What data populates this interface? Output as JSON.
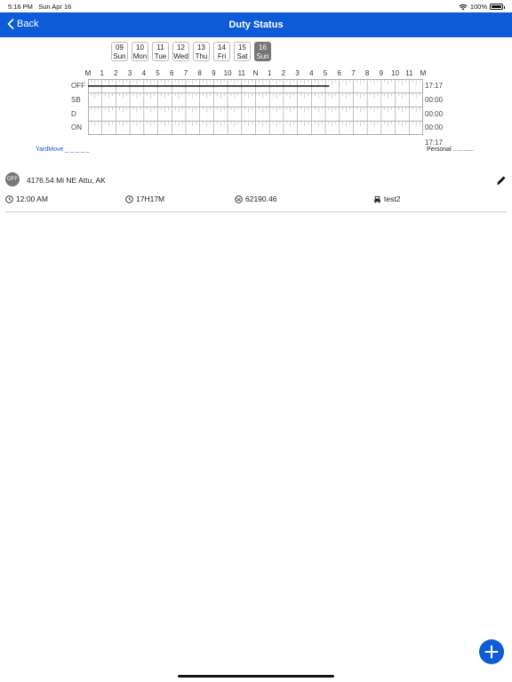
{
  "status_bar": {
    "time": "5:16 PM",
    "date": "Sun Apr 16",
    "battery": "100%"
  },
  "nav": {
    "back_label": "Back",
    "title": "Duty Status",
    "bar_color": "#0d5bd7"
  },
  "days": [
    {
      "num": "09",
      "name": "Sun",
      "selected": false
    },
    {
      "num": "10",
      "name": "Mon",
      "selected": false
    },
    {
      "num": "11",
      "name": "Tue",
      "selected": false
    },
    {
      "num": "12",
      "name": "Wed",
      "selected": false
    },
    {
      "num": "13",
      "name": "Thu",
      "selected": false
    },
    {
      "num": "14",
      "name": "Fri",
      "selected": false
    },
    {
      "num": "15",
      "name": "Sat",
      "selected": false
    },
    {
      "num": "16",
      "name": "Sun",
      "selected": true
    }
  ],
  "chart_data": {
    "type": "table",
    "hour_labels": [
      "M",
      "1",
      "2",
      "3",
      "4",
      "5",
      "6",
      "7",
      "8",
      "9",
      "10",
      "11",
      "N",
      "1",
      "2",
      "3",
      "4",
      "5",
      "6",
      "7",
      "8",
      "9",
      "10",
      "11",
      "M"
    ],
    "rows": [
      {
        "label": "OFF",
        "total": "17:17"
      },
      {
        "label": "SB",
        "total": "00:00"
      },
      {
        "label": "D",
        "total": "00:00"
      },
      {
        "label": "ON",
        "total": "00:00"
      }
    ],
    "segments": [
      {
        "status": "OFF",
        "start_hour": 0,
        "end_hour": 17.28
      }
    ],
    "total": "17:17"
  },
  "legend": {
    "yardmove": "YardMove",
    "personal": "Personal"
  },
  "log_entry": {
    "status": "OFF",
    "location": "4176.54 Mi NE Attu, AK",
    "time": "12:00 AM",
    "duration": "17H17M",
    "odometer": "62190.46",
    "vehicle": "test2"
  }
}
